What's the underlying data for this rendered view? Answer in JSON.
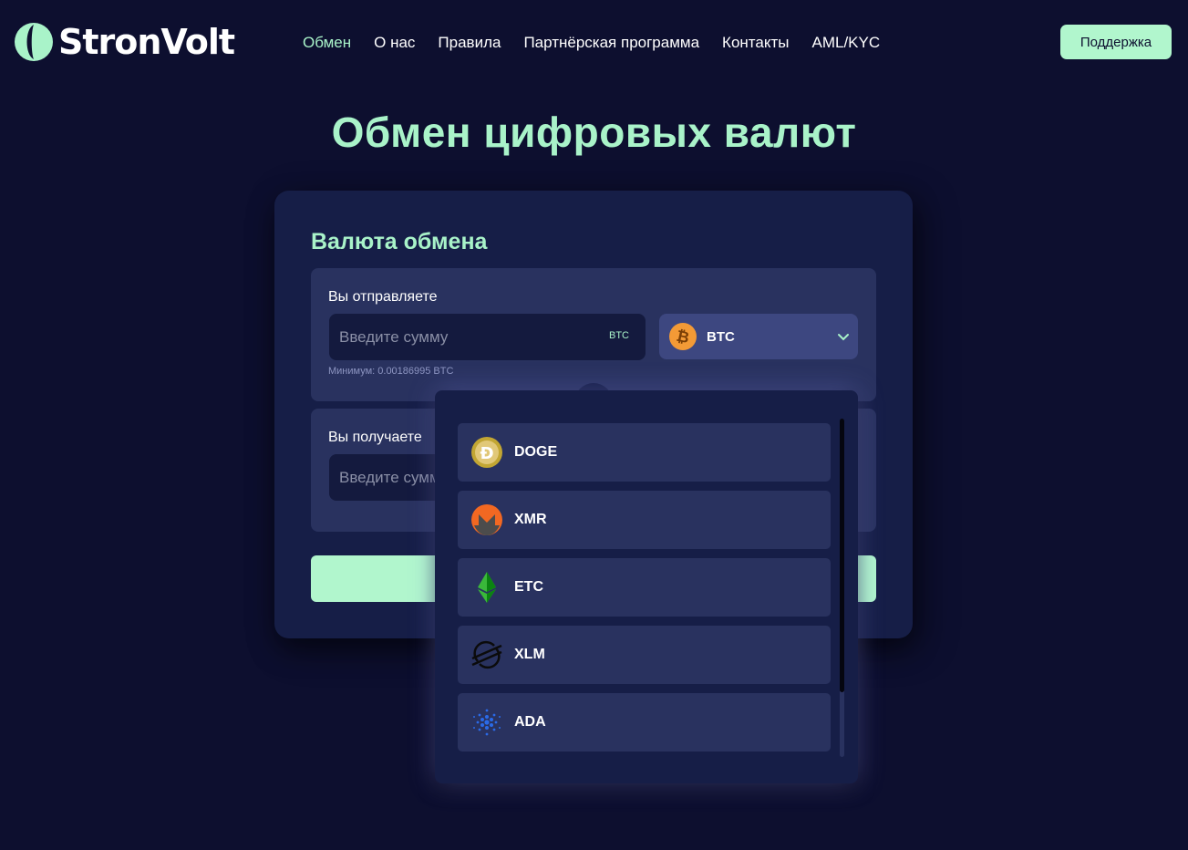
{
  "brand": {
    "name": "StronVolt",
    "accent": "#a9f3c9",
    "button": "#b1f6cd"
  },
  "nav": {
    "items": [
      {
        "label": "Обмен",
        "active": true
      },
      {
        "label": "О нас"
      },
      {
        "label": "Правила"
      },
      {
        "label": "Партнёрская программа"
      },
      {
        "label": "Контакты"
      },
      {
        "label": "AML/KYC"
      }
    ],
    "support_label": "Поддержка"
  },
  "page_title": "Обмен цифровых валют",
  "exchange": {
    "title": "Валюта обмена",
    "send": {
      "label": "Вы отправляете",
      "placeholder": "Введите сумму",
      "unit": "BTC",
      "currency": "BTC",
      "currency_icon": "bitcoin-icon",
      "min_note": "Минимум: 0.00186995 BTC"
    },
    "receive": {
      "label": "Вы получаете",
      "placeholder": "Введите сумму"
    }
  },
  "dropdown": {
    "items": [
      {
        "label": "DOGE",
        "icon": "dogecoin-icon"
      },
      {
        "label": "XMR",
        "icon": "monero-icon"
      },
      {
        "label": "ETC",
        "icon": "ethereum-classic-icon"
      },
      {
        "label": "XLM",
        "icon": "stellar-icon"
      },
      {
        "label": "ADA",
        "icon": "cardano-icon"
      }
    ]
  }
}
